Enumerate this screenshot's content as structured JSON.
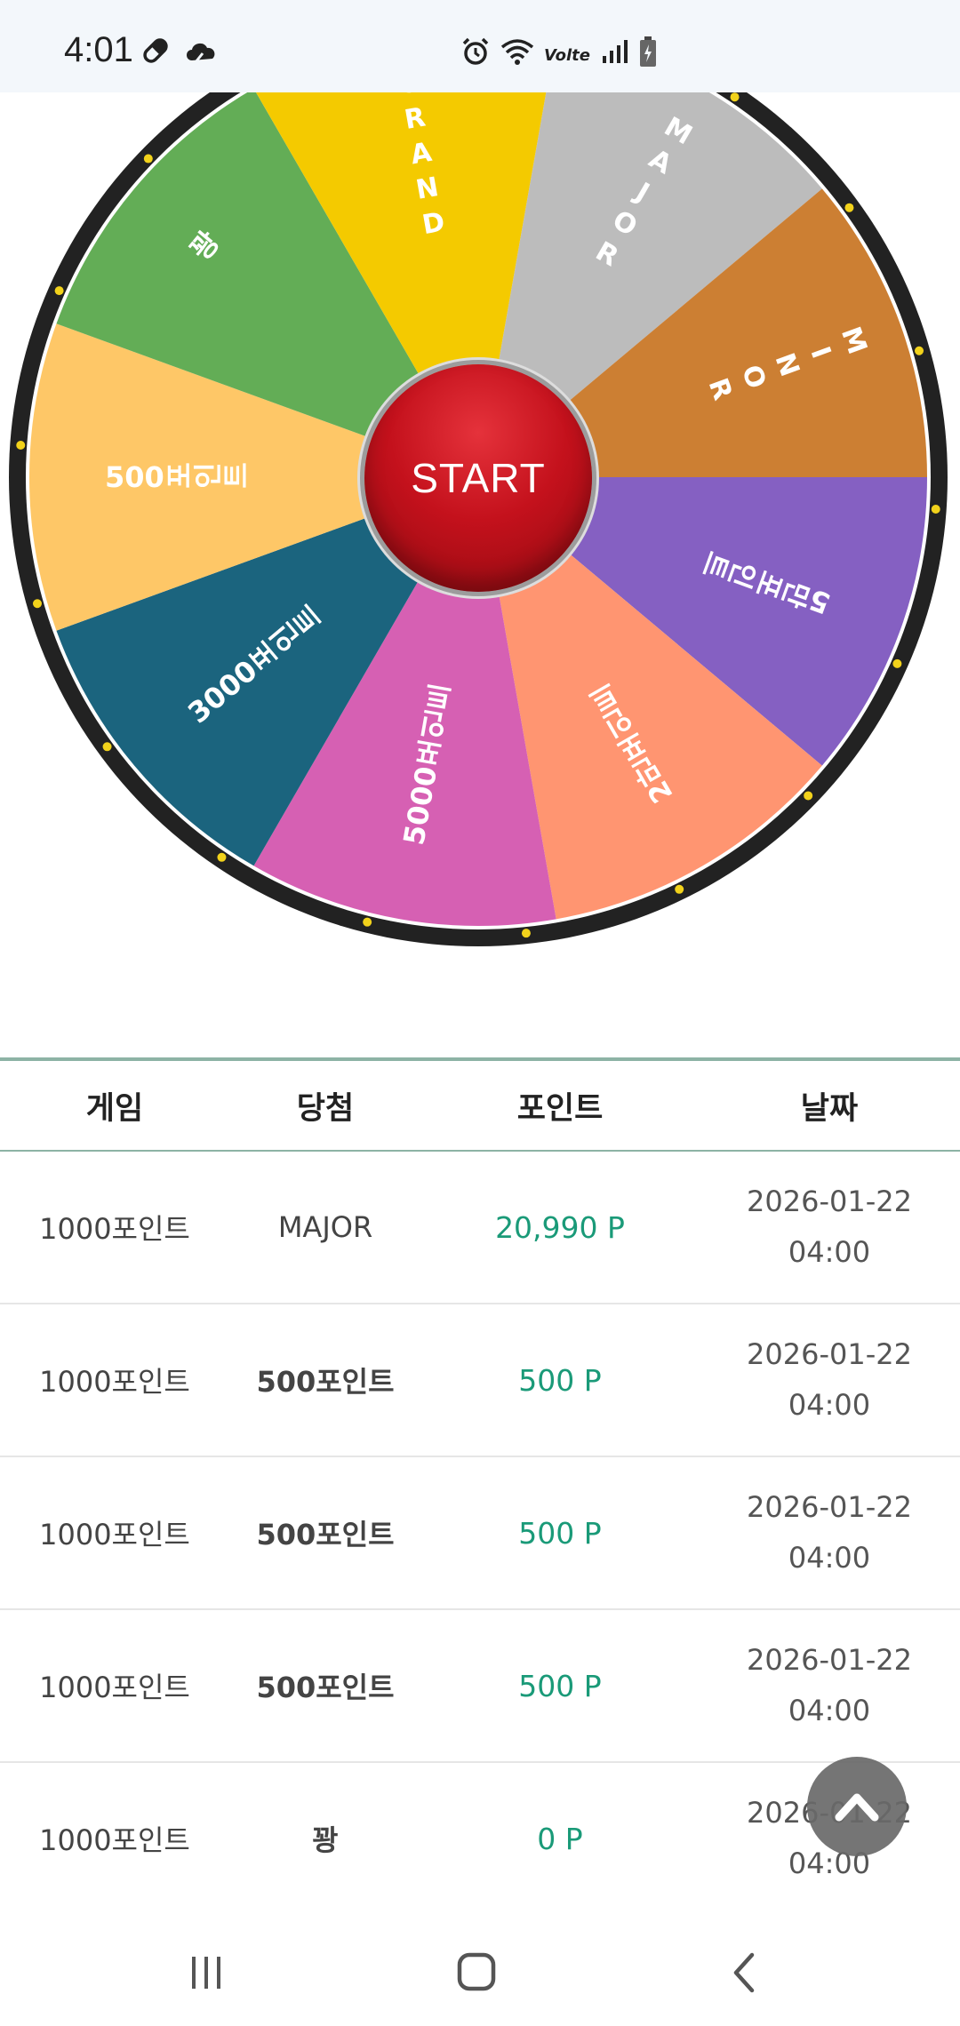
{
  "status_bar": {
    "time": "4:01",
    "left_icons": [
      "pill-icon",
      "cloud-icon"
    ],
    "right_icons": [
      "alarm-icon",
      "wifi-icon",
      "volte-icon",
      "signal-icon",
      "battery-icon"
    ],
    "volte_label": "Volte"
  },
  "wheel": {
    "start_label": "START",
    "segments": [
      {
        "label": "MAJOR",
        "color": "#bcbcbc"
      },
      {
        "label": "MINOR",
        "color": "#cc7f33"
      },
      {
        "label": "5만포인트",
        "color": "#8560c2"
      },
      {
        "label": "2만포인트",
        "color": "#ff9571"
      },
      {
        "label": "5000포인트",
        "color": "#d660b3"
      },
      {
        "label": "3000포인트",
        "color": "#1b647e"
      },
      {
        "label": "500포인트",
        "color": "#fec767"
      },
      {
        "label": "꽝",
        "color": "#63ad56"
      },
      {
        "label": "GRAND",
        "color": "#f4ca00"
      }
    ]
  },
  "table": {
    "headers": [
      "게임",
      "당첨",
      "포인트",
      "날짜"
    ],
    "rows": [
      {
        "game": "1000포인트",
        "win": "MAJOR",
        "point": "20,990 P",
        "date": "2026-01-22",
        "time": "04:00"
      },
      {
        "game": "1000포인트",
        "win": "500포인트",
        "point": "500 P",
        "date": "2026-01-22",
        "time": "04:00"
      },
      {
        "game": "1000포인트",
        "win": "500포인트",
        "point": "500 P",
        "date": "2026-01-22",
        "time": "04:00"
      },
      {
        "game": "1000포인트",
        "win": "500포인트",
        "point": "500 P",
        "date": "2026-01-22",
        "time": "04:00"
      },
      {
        "game": "1000포인트",
        "win": "꽝",
        "point": "0 P",
        "date": "2026-01-22",
        "time": "04:00"
      }
    ]
  },
  "scroll_top_icon": "chevron-up-icon",
  "nav": {
    "icons": [
      "recent-apps-icon",
      "home-icon",
      "back-icon"
    ]
  },
  "colors": {
    "accent_green": "#1a9a78",
    "table_border": "#8db3a5",
    "start_red": "#c4111c"
  }
}
